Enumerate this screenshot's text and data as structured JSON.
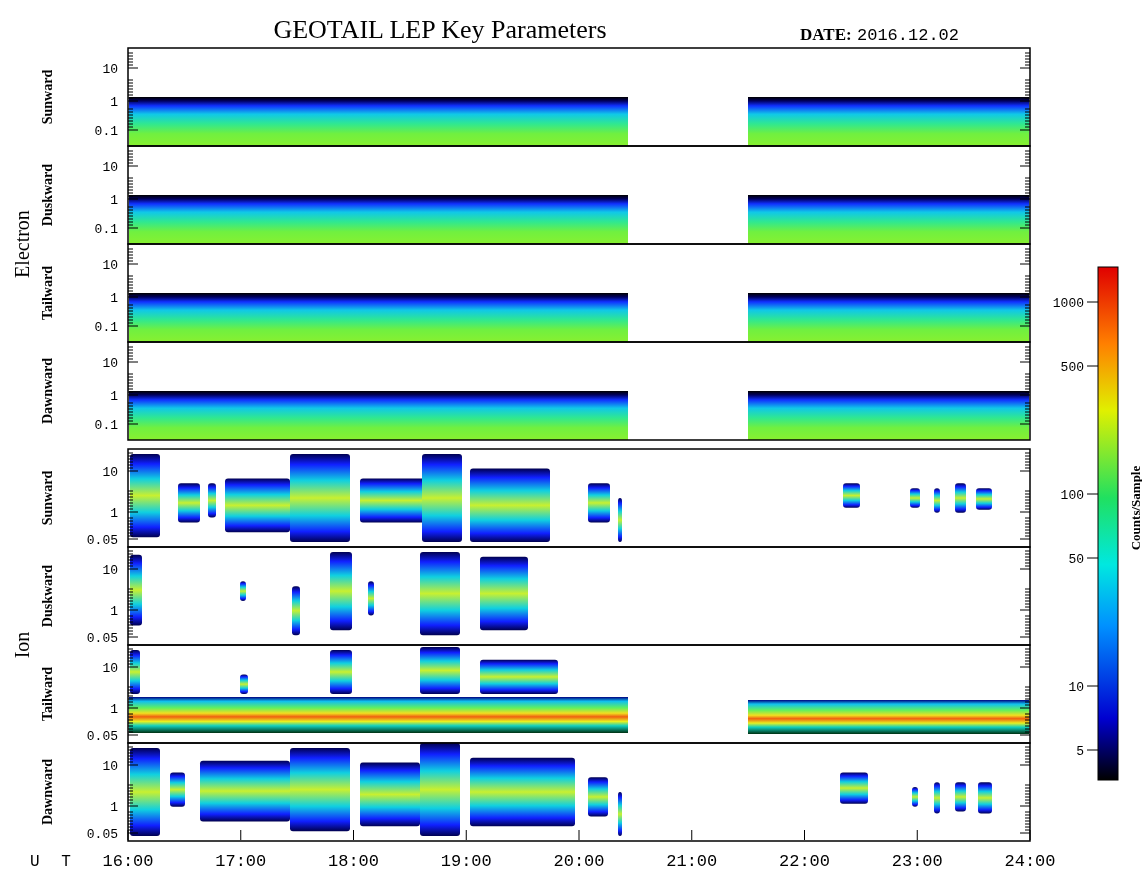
{
  "title": "GEOTAIL LEP Key Parameters",
  "date_label": "DATE:",
  "date": "2016.12.02",
  "groups": [
    {
      "label": "Electron",
      "panels": [
        {
          "label": "Sunward",
          "yticks": [
            "10",
            "1",
            "0.1"
          ]
        },
        {
          "label": "Duskward",
          "yticks": [
            "10",
            "1",
            "0.1"
          ]
        },
        {
          "label": "Tailward",
          "yticks": [
            "10",
            "1",
            "0.1"
          ]
        },
        {
          "label": "Dawnward",
          "yticks": [
            "10",
            "1",
            "0.1"
          ]
        }
      ]
    },
    {
      "label": "Ion",
      "panels": [
        {
          "label": "Sunward",
          "yticks": [
            "10",
            "1",
            "0.05"
          ]
        },
        {
          "label": "Duskward",
          "yticks": [
            "10",
            "1",
            "0.05"
          ]
        },
        {
          "label": "Tailward",
          "yticks": [
            "10",
            "1",
            "0.05"
          ]
        },
        {
          "label": "Dawnward",
          "yticks": [
            "10",
            "1",
            "0.05"
          ]
        }
      ]
    }
  ],
  "colorbar": {
    "label": "Counts/Sample",
    "ticks": [
      "1000",
      "500",
      "100",
      "50",
      "10",
      "5"
    ]
  },
  "x_axis": {
    "label": "U T",
    "ticks": [
      "16:00",
      "17:00",
      "18:00",
      "19:00",
      "20:00",
      "21:00",
      "22:00",
      "23:00",
      "24:00"
    ]
  }
}
